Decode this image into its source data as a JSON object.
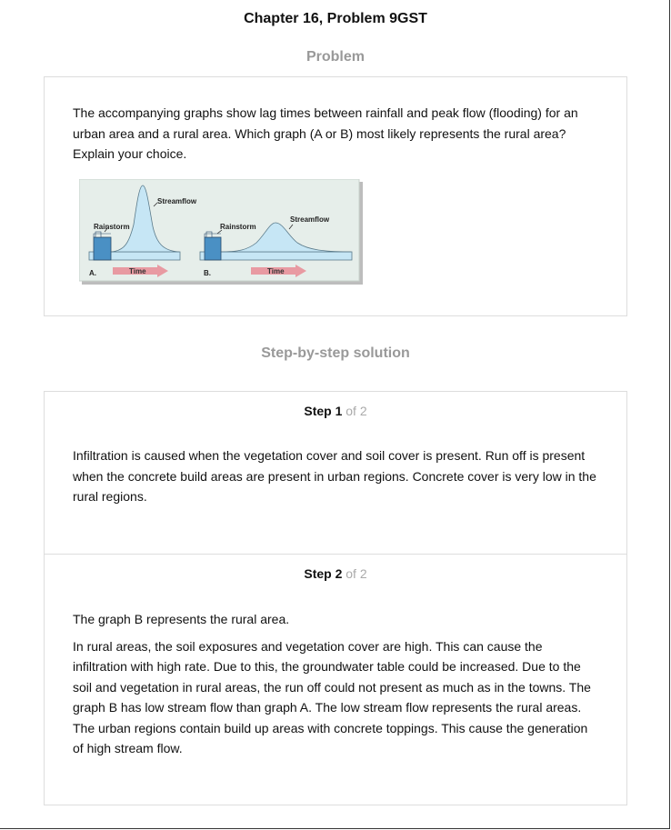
{
  "header": {
    "title": "Chapter 16, Problem 9GST"
  },
  "problem": {
    "heading": "Problem",
    "text": "The accompanying graphs show lag times between rainfall and peak flow (flooding) for an urban area and a rural area. Which graph (A or B) most likely represents the rural area? Explain your choice.",
    "figure": {
      "graph_a": {
        "panel_label": "A.",
        "rain_label": "Rainstorm",
        "flow_label": "Streamflow",
        "time_label": "Time"
      },
      "graph_b": {
        "panel_label": "B.",
        "rain_label": "Rainstorm",
        "flow_label": "Streamflow",
        "time_label": "Time"
      }
    }
  },
  "solution": {
    "heading": "Step-by-step solution",
    "steps": [
      {
        "label": "Step 1",
        "of_text": "of 2",
        "paragraphs": [
          "Infiltration is caused when the vegetation cover and soil cover is present. Run off is present when the concrete build areas are present in urban regions. Concrete cover is very low in the rural regions."
        ]
      },
      {
        "label": "Step 2",
        "of_text": "of 2",
        "paragraphs": [
          "The graph B represents the rural area.",
          "In rural areas, the soil exposures and vegetation cover are high. This can cause the infiltration with high rate. Due to this, the groundwater table could be increased. Due to the soil and vegetation in rural areas, the run off could not present as much as in the towns. The graph B has low stream flow than graph A. The low stream flow represents the rural areas. The urban regions contain build up areas with concrete toppings. This cause the generation of high stream flow."
        ]
      }
    ]
  },
  "colors": {
    "heading_gray": "#999999",
    "flow_fill": "#c6e6f5",
    "rain_fill": "#4a90c4",
    "arrow_fill": "#e89aa2",
    "figure_bg": "#e6eeea"
  }
}
